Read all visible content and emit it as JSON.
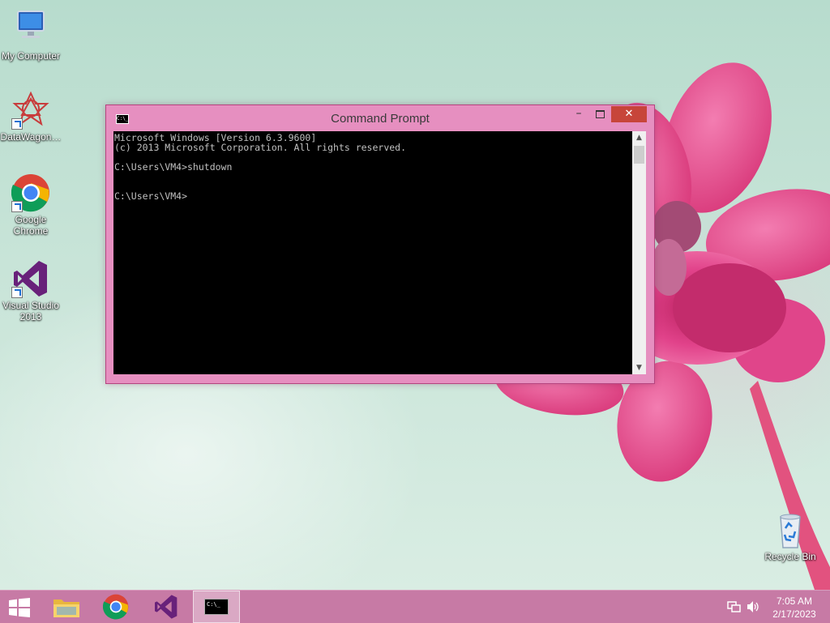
{
  "desktop": {
    "icons": [
      {
        "label": "My Computer",
        "icon": "computer-icon"
      },
      {
        "label": "DataWagon…",
        "icon": "datawagon-icon",
        "shortcut": true
      },
      {
        "label": "Google Chrome",
        "icon": "chrome-icon",
        "shortcut": true
      },
      {
        "label": "Visual Studio 2013",
        "icon": "visual-studio-icon",
        "shortcut": true
      },
      {
        "label": "Recycle Bin",
        "icon": "recycle-bin-icon"
      }
    ]
  },
  "window": {
    "title": "Command Prompt",
    "icon_text": "C:\\_",
    "controls": {
      "minimize": "–",
      "close": "✕"
    },
    "console_text": "Microsoft Windows [Version 6.3.9600]\n(c) 2013 Microsoft Corporation. All rights reserved.\n\nC:\\Users\\VM4>shutdown\n\n\nC:\\Users\\VM4>",
    "scroll_up": "▲",
    "scroll_down": "▼"
  },
  "taskbar": {
    "items": [
      {
        "name": "File Explorer",
        "icon": "folder-icon"
      },
      {
        "name": "Google Chrome",
        "icon": "chrome-icon"
      },
      {
        "name": "Visual Studio 2013",
        "icon": "visual-studio-icon"
      },
      {
        "name": "Command Prompt",
        "icon": "cmd-icon",
        "active": true
      }
    ],
    "cmd_icon_text": "C:\\_",
    "tray": {
      "network": "network-icon",
      "volume": "speaker-icon"
    },
    "clock": {
      "time": "7:05 AM",
      "date": "2/17/2023"
    }
  },
  "colors": {
    "titlebar": "#e68fc0",
    "taskbar": "#c77aa5",
    "close_button": "#c7453a",
    "console_bg": "#000000",
    "console_text": "#c0c0c0"
  }
}
